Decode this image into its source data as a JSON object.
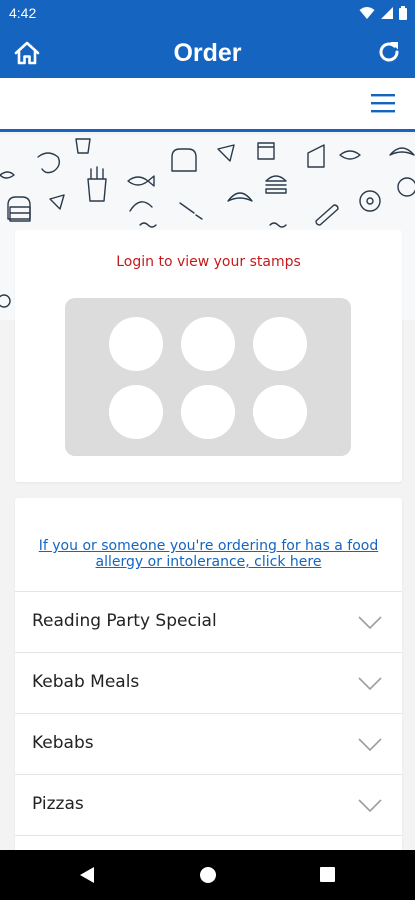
{
  "status_bar": {
    "time": "4:42"
  },
  "app_bar": {
    "title": "Order",
    "home_icon": "home-icon",
    "refresh_icon": "refresh-icon"
  },
  "sub_bar": {
    "menu_icon": "hamburger-menu-icon"
  },
  "stamps": {
    "title": "Login to view your stamps",
    "count": 6
  },
  "allergy": {
    "link_text": "If you or someone you're ordering for has a food allergy or intolerance, click here"
  },
  "categories": [
    {
      "label": "Reading Party Special"
    },
    {
      "label": "Kebab Meals"
    },
    {
      "label": "Kebabs"
    },
    {
      "label": "Pizzas"
    }
  ],
  "colors": {
    "brand": "#1565c0",
    "stamp_title": "#c41a1a",
    "stamp_panel": "#dcdcdc"
  }
}
